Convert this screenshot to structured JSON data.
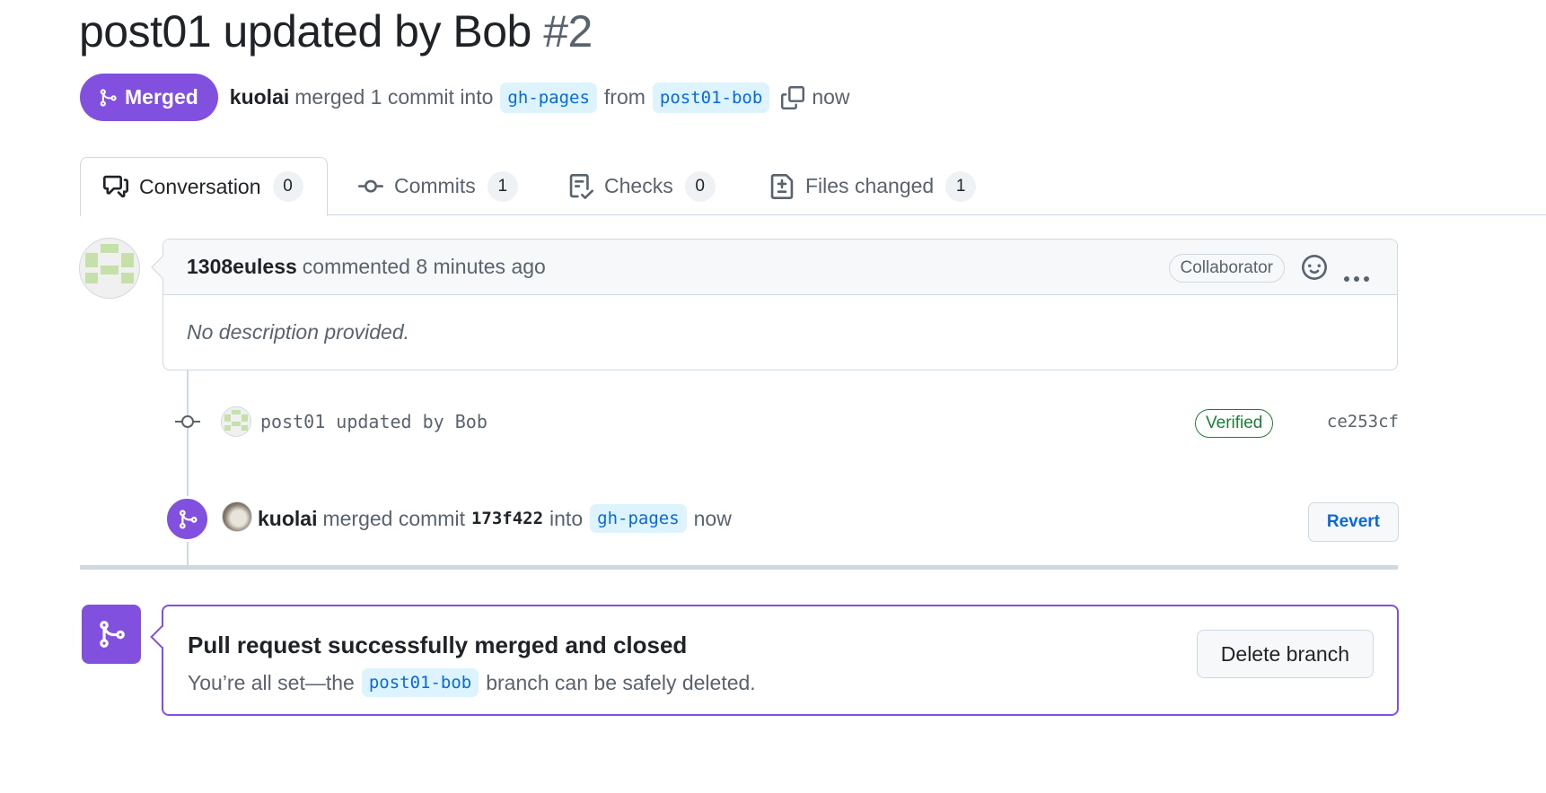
{
  "pr": {
    "title": "post01 updated by Bob",
    "number": "#2",
    "state_label": "Merged",
    "merger": "kuolai",
    "merge_text": "merged 1 commit into",
    "base_branch": "gh-pages",
    "from_text": "from",
    "head_branch": "post01-bob",
    "time": "now"
  },
  "tabs": [
    {
      "label": "Conversation",
      "count": "0",
      "icon": "comment-discussion-icon"
    },
    {
      "label": "Commits",
      "count": "1",
      "icon": "git-commit-icon"
    },
    {
      "label": "Checks",
      "count": "0",
      "icon": "checklist-icon"
    },
    {
      "label": "Files changed",
      "count": "1",
      "icon": "file-diff-icon"
    }
  ],
  "comment": {
    "author": "1308euless",
    "action": "commented 8 minutes ago",
    "role_badge": "Collaborator",
    "body": "No description provided."
  },
  "commit": {
    "message": "post01 updated by Bob",
    "verified_label": "Verified",
    "sha": "ce253cf"
  },
  "merge_event": {
    "actor": "kuolai",
    "text": "merged commit",
    "sha": "173f422",
    "into": "into",
    "branch": "gh-pages",
    "time": "now",
    "revert_label": "Revert"
  },
  "merged_box": {
    "title": "Pull request successfully merged and closed",
    "desc_before": "You’re all set—the",
    "branch": "post01-bob",
    "desc_after": "branch can be safely deleted.",
    "delete_label": "Delete branch"
  },
  "colors": {
    "merged_purple": "#8250df",
    "verified_green": "#1a7f37",
    "link_blue": "#0969da"
  }
}
